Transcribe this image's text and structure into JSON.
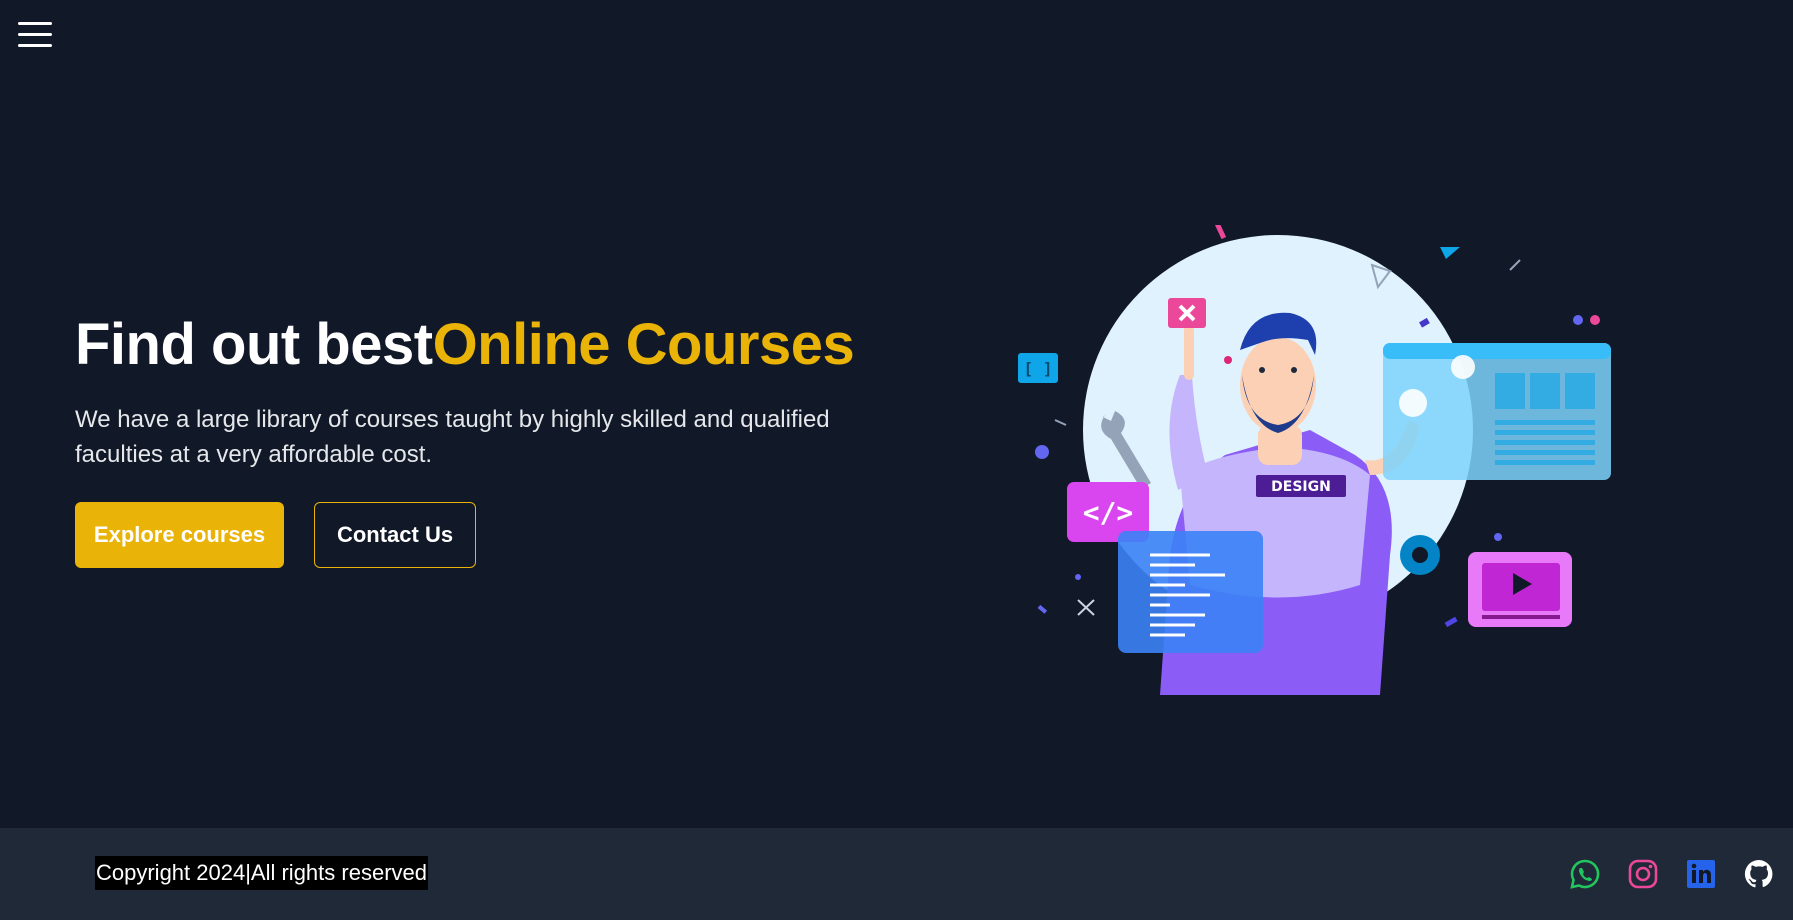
{
  "nav": {
    "menu_icon": "hamburger-menu-icon"
  },
  "hero": {
    "title_main": "Find out best",
    "title_accent": "Online Courses",
    "description": "We have a large library of courses taught by highly skilled and qualified faculties at a very affordable cost.",
    "primary_button": "Explore courses",
    "secondary_button": "Contact Us",
    "illustration": {
      "badge_text": "DESIGN",
      "code_icon_text": "</>",
      "bracket_text": "[ ]"
    }
  },
  "footer": {
    "copyright": "Copyright 2024|All rights reserved",
    "socials": [
      {
        "icon": "whatsapp-icon",
        "color": "#22c55e"
      },
      {
        "icon": "instagram-icon",
        "color": "#ec4899"
      },
      {
        "icon": "linkedin-icon",
        "color": "#2563eb"
      },
      {
        "icon": "github-icon",
        "color": "#ffffff"
      }
    ]
  },
  "colors": {
    "background": "#111827",
    "footer_bg": "#1f2937",
    "accent": "#eab308"
  }
}
